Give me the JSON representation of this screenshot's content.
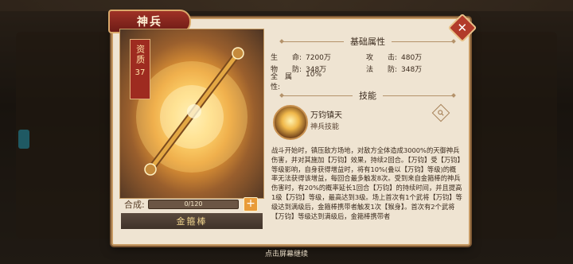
{
  "title": "神兵",
  "quality": {
    "label": "资质",
    "value": "37"
  },
  "sections": {
    "base_attrs": "基础属性",
    "skill": "技能"
  },
  "attributes": [
    [
      {
        "key": "生　　命:",
        "value": "7200万"
      },
      {
        "key": "攻　　击:",
        "value": "480万"
      }
    ],
    [
      {
        "key": "物　　防:",
        "value": "348万"
      },
      {
        "key": "法　　防:",
        "value": "348万"
      }
    ],
    [
      {
        "key": "全　属　性:",
        "value": "10%"
      }
    ]
  ],
  "skill": {
    "name": "万钧镇天",
    "type": "神兵技能",
    "description": "战斗开始时，镇压敌方场地，对敌方全体造成3000%的天御神兵伤害，并对其施加【万钧】效果，持续2回合。【万钧】受【万钧】等级影响，自身获得增益时，将有10%(叠以【万钧】等级)的概率无法获得该增益，每回合最多触发8次。受到来自金箍棒的神兵伤害时，有20%的概率延长1回合【万钧】的持续时间，并且提高1级【万钧】等级，最高达到3级。场上首次有1个武将【万钧】等级达到满级后，金箍棒携带者触发1次【猴身】。首次有2个武将【万钧】等级达到满级后，金箍棒携带者"
  },
  "synthesis": {
    "label": "合成:",
    "progress_text": "0/120",
    "progress": 0.0
  },
  "weapon_name": "金箍棒",
  "hint": "点击屏幕继续",
  "colors": {
    "accent": "#9e3126",
    "panel": "#efe4d2",
    "border": "#c79a63"
  }
}
